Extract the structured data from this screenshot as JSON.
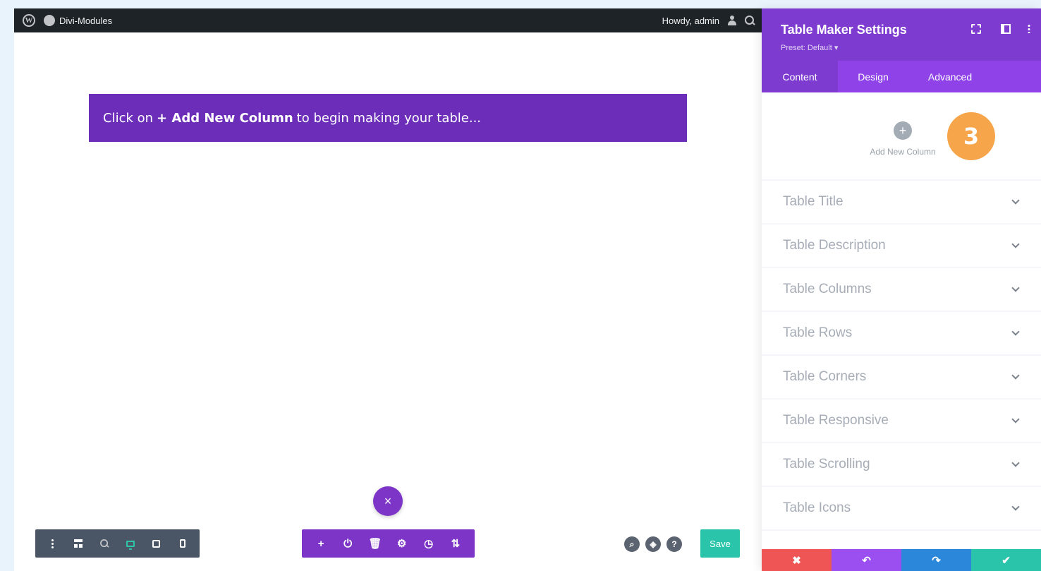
{
  "adminbar": {
    "site_name": "Divi-Modules",
    "greeting": "Howdy, admin"
  },
  "canvas": {
    "notice": {
      "prefix": "Click on",
      "highlight": "+ Add New Column",
      "suffix": "to begin making your table..."
    },
    "close_symbol": "×"
  },
  "toolbar_left": {
    "icons": [
      "menu-dots-icon",
      "wireframe-icon",
      "zoom-icon",
      "desktop-icon",
      "tablet-icon",
      "phone-icon"
    ]
  },
  "toolbar_mid": {
    "buttons": [
      "+",
      "⏻",
      "🗑",
      "⚙",
      "◷",
      "⇅"
    ]
  },
  "toolbar_right": {
    "round": [
      "⌕",
      "◈",
      "?"
    ],
    "save_label": "Save"
  },
  "panel": {
    "title": "Table Maker Settings",
    "preset": "Preset: Default ▾",
    "tabs": [
      "Content",
      "Design",
      "Advanced"
    ],
    "active_tab": "Content",
    "add_column_label": "Add New Column",
    "step_badge": "3",
    "toggles": [
      "Table Title",
      "Table Description",
      "Table Columns",
      "Table Rows",
      "Table Corners",
      "Table Responsive",
      "Table Scrolling",
      "Table Icons"
    ],
    "footer": {
      "cancel": "✖",
      "undo": "↶",
      "redo": "↷",
      "ok": "✔"
    }
  },
  "colors": {
    "purple": "#7e3bd0",
    "notice_purple": "#6c2eb9",
    "teal": "#29c4a9",
    "red": "#ef5555",
    "blue": "#2b87da",
    "orange": "#f7a54a"
  }
}
